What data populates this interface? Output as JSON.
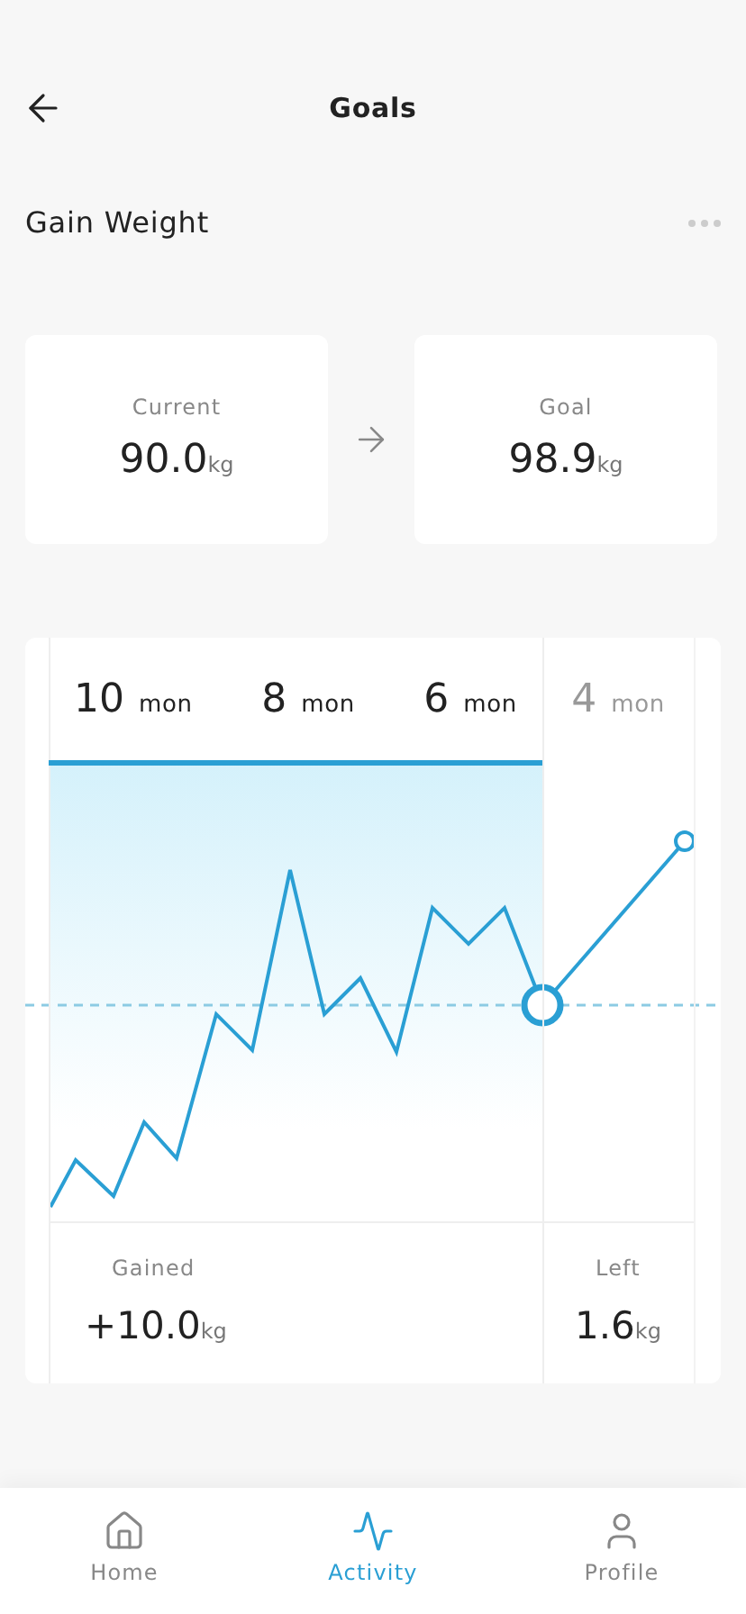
{
  "header": {
    "title": "Goals"
  },
  "goal": {
    "name": "Gain Weight"
  },
  "cards": [
    {
      "label": "Current",
      "value": "90.0",
      "unit": "kg"
    },
    {
      "label": "Goal",
      "value": "98.9",
      "unit": "kg"
    }
  ],
  "timeline": [
    {
      "number": "10",
      "unit": "mon",
      "elapsed": true
    },
    {
      "number": "8",
      "unit": "mon",
      "elapsed": true
    },
    {
      "number": "6",
      "unit": "mon",
      "elapsed": true
    },
    {
      "number": "4",
      "unit": "mon",
      "elapsed": false
    }
  ],
  "stats": {
    "gained": {
      "label": "Gained",
      "value": "+10.0",
      "unit": "kg"
    },
    "left": {
      "label": "Left",
      "value": "1.6",
      "unit": "kg"
    }
  },
  "nav": [
    {
      "label": "Home",
      "selected": false
    },
    {
      "label": "Activity",
      "selected": true
    },
    {
      "label": "Profile",
      "selected": false
    }
  ]
}
